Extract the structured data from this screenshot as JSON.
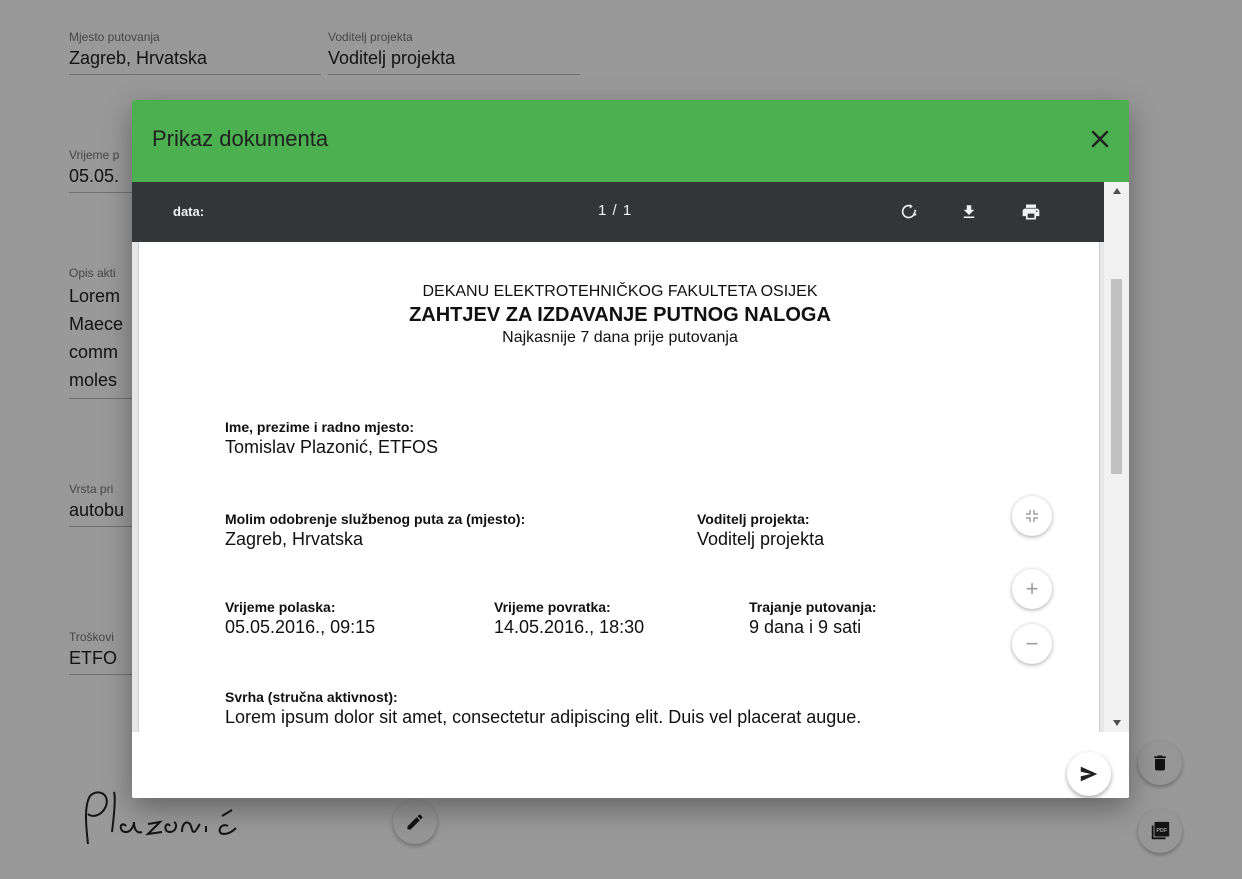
{
  "form": {
    "destination": {
      "label": "Mjesto putovanja",
      "value": "Zagreb, Hrvatska"
    },
    "project_lead": {
      "label": "Voditelj projekta",
      "value": "Voditelj projekta"
    },
    "departure": {
      "label": "Vrijeme p",
      "value": "05.05."
    },
    "description": {
      "label": "Opis akti",
      "lines": [
        "Lorem",
        "Maece",
        "comm",
        "moles"
      ]
    },
    "transport": {
      "label": "Vrsta pri",
      "value": "autobu"
    },
    "costs": {
      "label": "Troškovi",
      "value": "ETFO"
    },
    "signature": {
      "text": "Plazonić"
    }
  },
  "dialog": {
    "title": "Prikaz dokumenta",
    "close_icon": "close-icon",
    "viewer": {
      "file_name": "data:",
      "page_indicator": "1 / 1",
      "toolbar_icons": [
        "rotate-icon",
        "download-icon",
        "print-icon"
      ]
    },
    "document": {
      "dean": "DEKANU ELEKTROTEHNIČKOG FAKULTETA OSIJEK",
      "title": "ZAHTJEV ZA IZDAVANJE PUTNOG NALOGA",
      "subtitle": "Najkasnije 7 dana prije putovanja",
      "name_label": "Ime, prezime i radno mjesto:",
      "name_value": "Tomislav Plazonić, ETFOS",
      "destination_label": "Molim odobrenje službenog puta za (mjesto):",
      "destination_value": "Zagreb, Hrvatska",
      "lead_label": "Voditelj projekta:",
      "lead_value": "Voditelj projekta",
      "departure_label": "Vrijeme polaska:",
      "departure_value": "05.05.2016., 09:15",
      "return_label": "Vrijeme povratka:",
      "return_value": "14.05.2016., 18:30",
      "duration_label": "Trajanje putovanja:",
      "duration_value": "9 dana i 9 sati",
      "purpose_label": "Svrha (stručna aktivnost):",
      "purpose_value": "Lorem ipsum dolor sit amet, consectetur adipiscing elit. Duis vel placerat augue."
    },
    "zoom": {
      "plus": "+",
      "minus": "−"
    }
  },
  "colors": {
    "header_green": "#4caf50",
    "pdf_toolbar": "#323639",
    "overlay": "rgba(0,0,0,0.40)"
  }
}
